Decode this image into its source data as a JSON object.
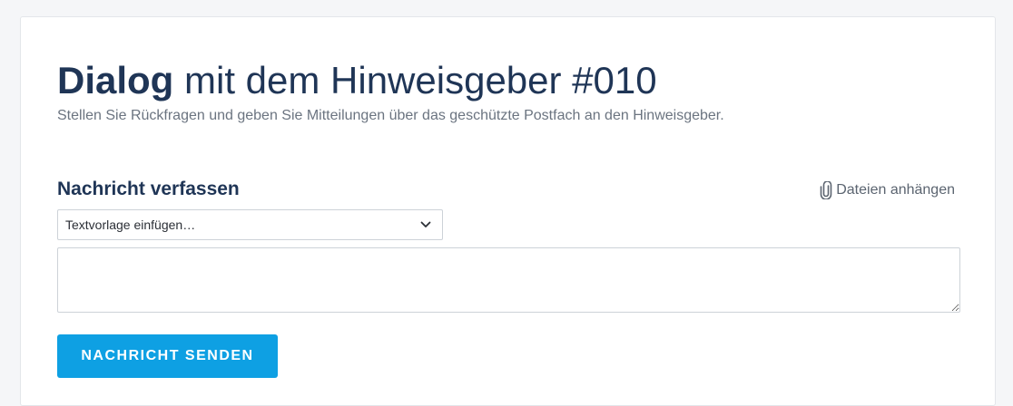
{
  "header": {
    "title_bold": "Dialog",
    "title_rest": " mit dem Hinweisgeber #010",
    "subtitle": "Stellen Sie Rückfragen und geben Sie Mitteilungen über das geschützte Postfach an den Hinweisgeber."
  },
  "compose": {
    "heading": "Nachricht verfassen",
    "attach_label": "Dateien anhängen",
    "attach_icon": "paperclip-icon",
    "template_select": {
      "selected": "Textvorlage einfügen…",
      "icon": "chevron-down-icon"
    },
    "message": {
      "value": "",
      "placeholder": ""
    },
    "send_label": "NACHRICHT SENDEN"
  },
  "colors": {
    "primary": "#0ea0e3",
    "heading": "#1f3556",
    "muted": "#6b7480",
    "background": "#f5f6f8"
  }
}
